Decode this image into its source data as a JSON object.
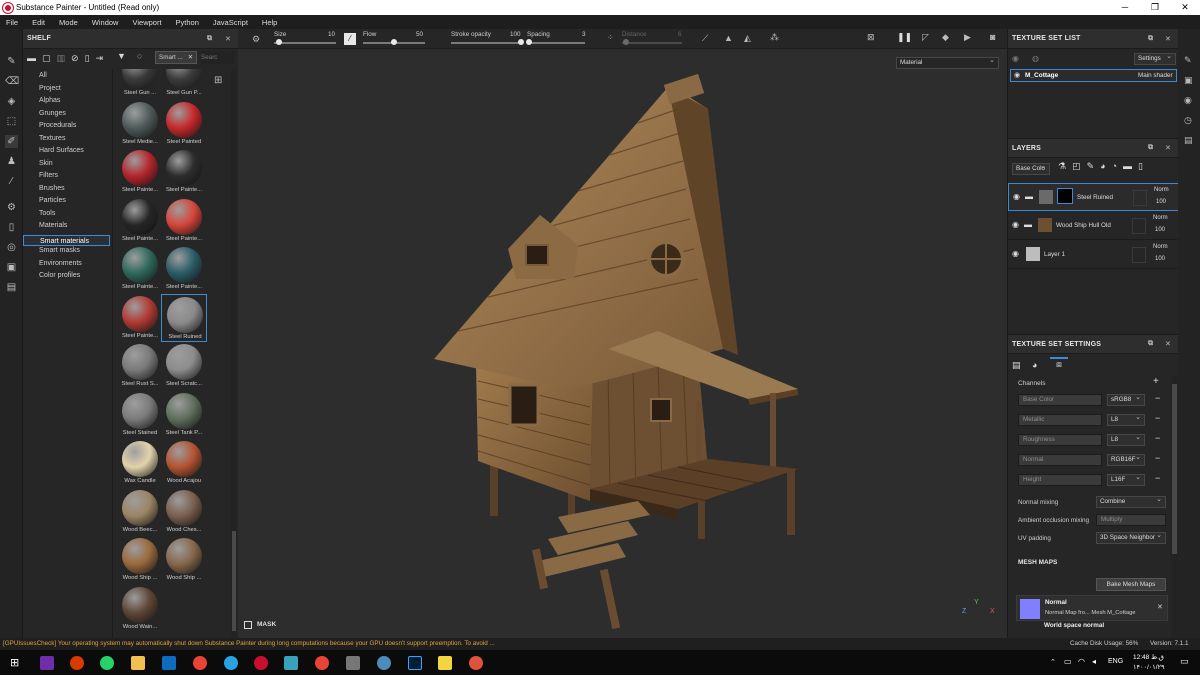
{
  "window": {
    "title": "Substance Painter - Untitled (Read only)"
  },
  "menu": [
    "File",
    "Edit",
    "Mode",
    "Window",
    "Viewport",
    "Python",
    "JavaScript",
    "Help"
  ],
  "shelf": {
    "title": "SHELF",
    "search_tag": "Smart ...",
    "search_placeholder": "Searc",
    "categories": [
      "All",
      "Project",
      "Alphas",
      "Grunges",
      "Procedurals",
      "Textures",
      "Hard Surfaces",
      "Skin",
      "Filters",
      "Brushes",
      "Particles",
      "Tools",
      "Materials",
      "Smart materials",
      "Smart masks",
      "Environments",
      "Color profiles"
    ],
    "selected_category": "Smart materials",
    "materials": [
      {
        "name": "Steel Gun ...",
        "color": "#3a3a3a"
      },
      {
        "name": "Steel Gun P...",
        "color": "#3c3c3c"
      },
      {
        "name": "Steel Medie...",
        "color": "#505a5a"
      },
      {
        "name": "Steel Painted",
        "color": "#c6282b"
      },
      {
        "name": "Steel Painte...",
        "color": "#b5252c"
      },
      {
        "name": "Steel Painte...",
        "color": "#2d2d2d"
      },
      {
        "name": "Steel Painte...",
        "color": "#262626"
      },
      {
        "name": "Steel Painte...",
        "color": "#d6453a"
      },
      {
        "name": "Steel Painte...",
        "color": "#2f6a5c"
      },
      {
        "name": "Steel Painte...",
        "color": "#2b5d68"
      },
      {
        "name": "Steel Painte...",
        "color": "#b23a34"
      },
      {
        "name": "Steel Ruined",
        "color": "#8a8a8a"
      },
      {
        "name": "Steel Rust S...",
        "color": "#7a7a7a"
      },
      {
        "name": "Steel Scratc...",
        "color": "#8c8c8c"
      },
      {
        "name": "Steel Stained",
        "color": "#7b7b7b"
      },
      {
        "name": "Steel Tank P...",
        "color": "#5f6f5d"
      },
      {
        "name": "Wax Candle",
        "color": "#e2d3aa"
      },
      {
        "name": "Wood Acajou",
        "color": "#b45431"
      },
      {
        "name": "Wood Beec...",
        "color": "#9a8565"
      },
      {
        "name": "Wood Ches...",
        "color": "#7a5f4d"
      },
      {
        "name": "Wood Ship ...",
        "color": "#9a6a3d"
      },
      {
        "name": "Wood Ship ...",
        "color": "#86674c"
      },
      {
        "name": "Wood Wain...",
        "color": "#5e4636"
      }
    ],
    "selected_material": "Steel Ruined"
  },
  "toolbar": {
    "size_label": "Size",
    "size_value": "10",
    "flow_label": "Flow",
    "flow_value": "50",
    "stroke_opacity_label": "Stroke opacity",
    "stroke_opacity_value": "100",
    "spacing_label": "Spacing",
    "spacing_value": "3",
    "distance_label": "Distance",
    "distance_value": "6",
    "fills": {
      "size": 0.08,
      "flow": 0.5,
      "stroke_opacity": 1.0,
      "spacing": 0.03,
      "distance": 0.06
    }
  },
  "viewport": {
    "mode_select": "Material",
    "mask_label": "MASK",
    "axis_labels": [
      "Y",
      "Z",
      "X"
    ]
  },
  "texture_set_list": {
    "title": "TEXTURE SET LIST",
    "settings_label": "Settings",
    "item": "M_Cottage",
    "shader": "Main shader"
  },
  "layers": {
    "title": "LAYERS",
    "channel_select": "Base Colo",
    "items": [
      {
        "name": "Steel Ruined",
        "blend": "Norm",
        "opacity": "100",
        "selected": true
      },
      {
        "name": "Wood Ship Hull Old",
        "blend": "Norm",
        "opacity": "100",
        "selected": false
      },
      {
        "name": "Layer 1",
        "blend": "Norm",
        "opacity": "100",
        "selected": false
      }
    ]
  },
  "texture_set_settings": {
    "title": "TEXTURE SET SETTINGS",
    "channels_label": "Channels",
    "channels": [
      {
        "name": "Base Color",
        "format": "sRGB8"
      },
      {
        "name": "Metallic",
        "format": "L8"
      },
      {
        "name": "Roughness",
        "format": "L8"
      },
      {
        "name": "Normal",
        "format": "RGB16F"
      },
      {
        "name": "Height",
        "format": "L16F"
      }
    ],
    "normal_mixing_label": "Normal mixing",
    "normal_mixing": "Combine",
    "ao_mixing_label": "Ambient occlusion mixing",
    "ao_mixing": "Multiply",
    "uv_padding_label": "UV padding",
    "uv_padding": "3D Space Neighbor",
    "mesh_maps_label": "MESH MAPS",
    "bake_button": "Bake Mesh Maps",
    "mesh_map_title": "Normal",
    "mesh_map_sub": "Normal Map fro... Mesh M_Cottage",
    "mesh_map_next": "World space normal"
  },
  "status": {
    "message": "[GPUIssuesCheck] Your operating system may automatically shut down Substance Painter during long computations because your GPU doesn't support preemption. To avoid ...",
    "cache": "Cache Disk Usage:",
    "cache_value": "56%",
    "version": "Version: 7.1.1"
  },
  "taskbar": {
    "lang": "ENG",
    "time": "12:48 ق.ظ",
    "date": "۱۴۰۰/۰۱/۲۹"
  }
}
